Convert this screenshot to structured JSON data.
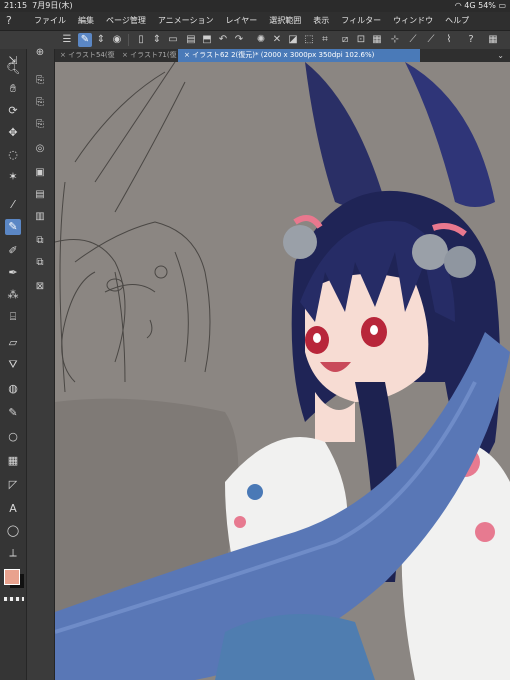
{
  "status": {
    "time": "21:15",
    "date": "7月9日(木)",
    "signal": "4G",
    "battery": "54%"
  },
  "menu": [
    "ファイル",
    "編集",
    "ページ管理",
    "アニメーション",
    "レイヤー",
    "選択範囲",
    "表示",
    "フィルター",
    "ウィンドウ",
    "ヘルプ"
  ],
  "tabs": [
    {
      "label": "イラスト54(復"
    },
    {
      "label": "イラスト71(復"
    },
    {
      "label": "イラスト62 2(復元)* (2000 x 3000px 350dpi 102.6%)"
    }
  ],
  "colors": {
    "main": "#e9a28e",
    "sub": "#111111",
    "accent": "#5b87c5"
  },
  "icons": {
    "left": [
      "transform-icon",
      "zoom-icon",
      "hand-icon",
      "rotate-icon",
      "move-icon",
      "lasso-icon",
      "magic-wand-icon",
      "eyedropper-icon",
      "pen-icon",
      "pencil-icon",
      "brush-icon",
      "airbrush-icon",
      "decoration-icon",
      "eraser-icon",
      "fill-icon",
      "blend-icon",
      "figure-icon",
      "ellipse-icon",
      "frame-icon",
      "text-icon",
      "balloon-icon",
      "ruler-icon"
    ]
  }
}
